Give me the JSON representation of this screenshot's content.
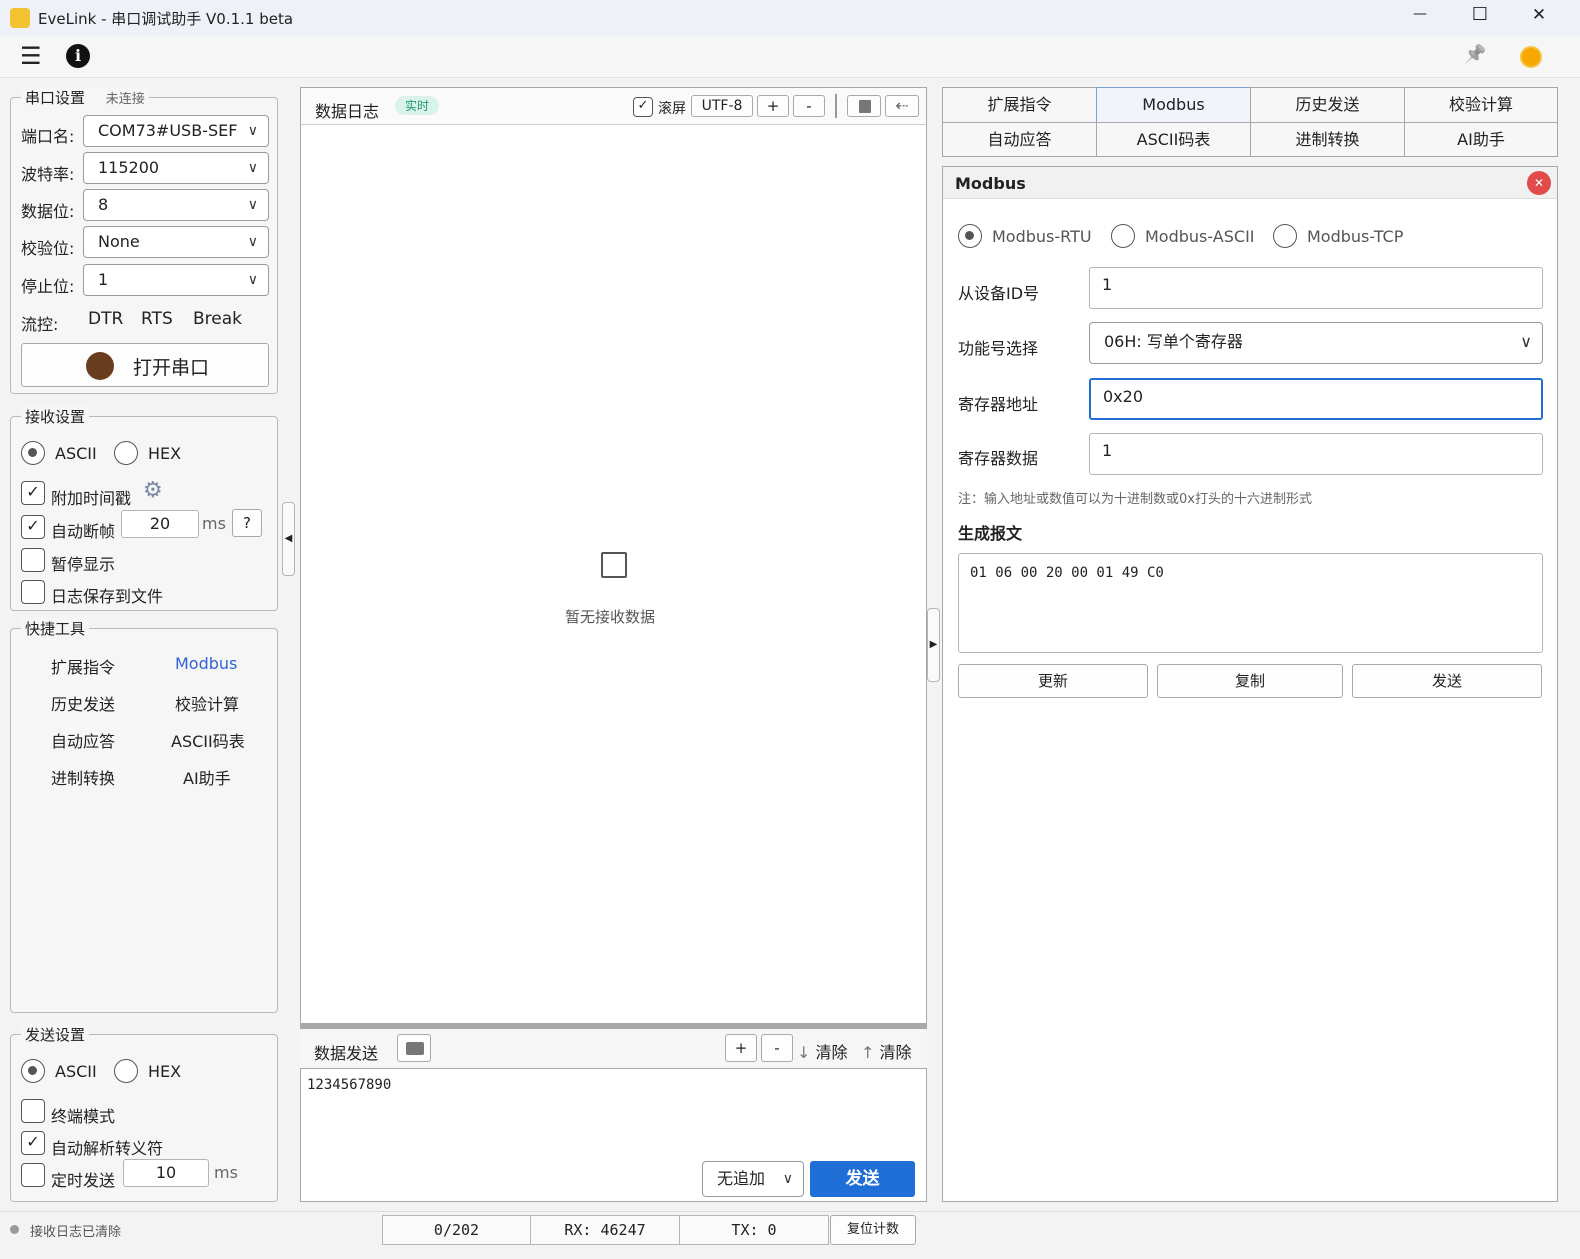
{
  "window": {
    "title": "EveLink - 串口调试助手 V0.1.1 beta",
    "minimize": "—",
    "maximize": "☐",
    "close": "✕"
  },
  "toolbar": {
    "menu_icon": "☰",
    "info_icon": "i",
    "pin_icon": "📌",
    "theme_icon": "☀"
  },
  "serial": {
    "legend": "串口设置",
    "status": "未连接",
    "port_label": "端口名:",
    "port_value": "COM73#USB-SEF",
    "baud_label": "波特率:",
    "baud_value": "115200",
    "data_label": "数据位:",
    "data_value": "8",
    "parity_label": "校验位:",
    "parity_value": "None",
    "stop_label": "停止位:",
    "stop_value": "1",
    "flow_label": "流控:",
    "dtr": "DTR",
    "rts": "RTS",
    "brk": "Break",
    "open_button": "打开串口",
    "led_color": "#6b3d1f"
  },
  "receive": {
    "legend": "接收设置",
    "ascii": "ASCII",
    "hex": "HEX",
    "timestamp": "附加时间戳",
    "auto_frame": "自动断帧",
    "frame_ms": "20",
    "ms": "ms",
    "help": "?",
    "pause": "暂停显示",
    "save_log": "日志保存到文件"
  },
  "tools": {
    "legend": "快捷工具",
    "items": [
      "扩展指令",
      "Modbus",
      "历史发送",
      "校验计算",
      "自动应答",
      "ASCII码表",
      "进制转换",
      "AI助手"
    ],
    "accent": "#2f62d6"
  },
  "send_settings": {
    "legend": "发送设置",
    "ascii": "ASCII",
    "hex": "HEX",
    "terminal": "终端模式",
    "escape": "自动解析转义符",
    "timer": "定时发送",
    "timer_ms": "10",
    "ms": "ms"
  },
  "log": {
    "title": "数据日志",
    "badge": "实时",
    "scroll": "滚屏",
    "encoding": "UTF-8",
    "plus": "+",
    "minus": "-",
    "empty": "暂无接收数据"
  },
  "send": {
    "title": "数据发送",
    "plus": "+",
    "minus": "-",
    "clear_down": "清除",
    "clear_up": "清除",
    "content": "1234567890",
    "append": "无追加",
    "send_button": "发送",
    "accent": "#1f6fd6"
  },
  "tabs": {
    "row1": [
      "扩展指令",
      "Modbus",
      "历史发送",
      "校验计算"
    ],
    "row2": [
      "自动应答",
      "ASCII码表",
      "进制转换",
      "AI助手"
    ]
  },
  "modbus": {
    "title": "Modbus",
    "close": "✕",
    "modes": [
      "Modbus-RTU",
      "Modbus-ASCII",
      "Modbus-TCP"
    ],
    "slave_label": "从设备ID号",
    "slave_value": "1",
    "func_label": "功能号选择",
    "func_value": "06H: 写单个寄存器",
    "addr_label": "寄存器地址",
    "addr_value": "0x20",
    "data_label": "寄存器数据",
    "data_value": "1",
    "note": "注：输入地址或数值可以为十进制数或0x打头的十六进制形式",
    "gen_title": "生成报文",
    "gen_value": "01 06 00 20 00 01 49 C0",
    "update": "更新",
    "copy": "复制",
    "send": "发送"
  },
  "status": {
    "message": "接收日志已清除",
    "count": "0/202",
    "rx": "RX: 46247",
    "tx": "TX: 0",
    "reset": "复位计数"
  }
}
